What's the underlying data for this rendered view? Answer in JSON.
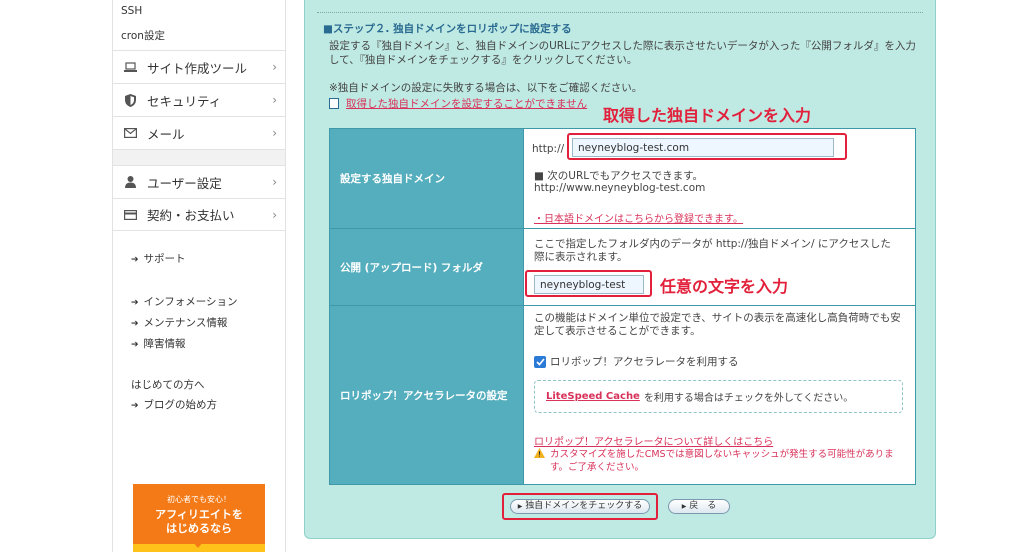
{
  "sidebar": {
    "top_items": [
      "SSH",
      "cron設定"
    ],
    "menu": [
      {
        "icon": "laptop-icon",
        "label": "サイト作成ツール"
      },
      {
        "icon": "shield-icon",
        "label": "セキュリティ"
      },
      {
        "icon": "mail-icon",
        "label": "メール"
      }
    ],
    "menu2": [
      {
        "icon": "user-icon",
        "label": "ユーザー設定"
      },
      {
        "icon": "card-icon",
        "label": "契約・お支払い"
      }
    ],
    "support": "サポート",
    "info_links": [
      "インフォメーション",
      "メンテナンス情報",
      "障害情報"
    ],
    "beginner_heading": "はじめての方へ",
    "blog_link": "ブログの始め方",
    "banner": {
      "small": "初心者でも安心！",
      "line1": "アフィリエイトを",
      "line2": "はじめるなら"
    }
  },
  "main": {
    "step_title": "■ステップ２. 独自ドメインをロリポップに設定する",
    "desc_line1": "設定する『独自ドメイン』と、独自ドメインのURLにアクセスした際に表示させたいデータが入った『公開フォルダ』を入力",
    "desc_line2": "して、『独自ドメインをチェックする』をクリックしてください。",
    "note": "※独自ドメインの設定に失敗する場合は、以下をご確認ください。",
    "help_link": "取得した独自ドメインを設定することができません",
    "annotation1": "取得した独自ドメインを入力",
    "annotation2": "任意の文字を入力"
  },
  "form": {
    "domain_label": "設定する独自ドメイン",
    "http_prefix": "http://",
    "domain_value": "neyneyblog-test.com",
    "also_access": "■ 次のURLでもアクセスできます。",
    "www_url": "http://www.neyneyblog-test.com",
    "jp_domain_link": "・日本語ドメインはこちらから登録できます。",
    "folder_label": "公開 (アップロード) フォルダ",
    "folder_desc1": "ここで指定したフォルダ内のデータが http://独自ドメイン/ にアクセスした",
    "folder_desc2": "際に表示されます。",
    "folder_value": "neyneyblog-test",
    "accel_label": "ロリポップ！アクセラレータの設定",
    "accel_desc1": "この機能はドメイン単位で設定でき、サイトの表示を高速化し高負荷時でも安",
    "accel_desc2": "定して表示させることができます。",
    "accel_checkbox": "ロリポップ！アクセラレータを利用する",
    "litespeed": "LiteSpeed Cache",
    "litespeed_rest": "を利用する場合はチェックを外してください。",
    "accel_more_link": "ロリポップ！アクセラレータについて詳しくはこちら",
    "warning1": "カスタマイズを施したCMSでは意図しないキャッシュが発生する可能性がありま",
    "warning2": "す。ご了承ください。"
  },
  "buttons": {
    "check": "独自ドメインをチェックする",
    "back": "戻　る"
  },
  "colors": {
    "accent": "#e3203b",
    "panel": "#bfe9e3",
    "label_bg": "#55aebd"
  }
}
